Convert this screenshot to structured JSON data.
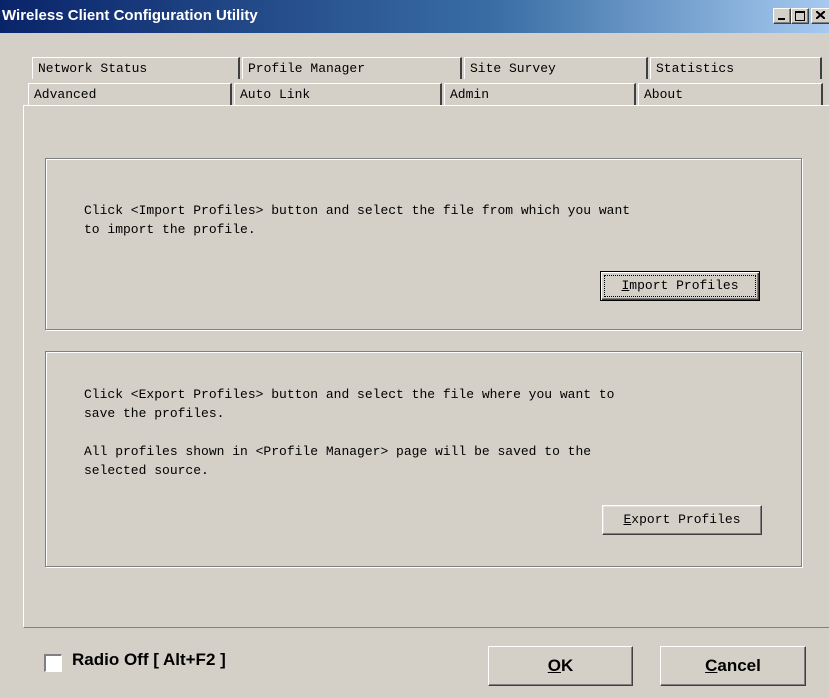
{
  "window": {
    "title": "Wireless Client Configuration Utility",
    "controls": [
      "minimize-icon",
      "maximize-icon",
      "close-icon"
    ]
  },
  "tabs": {
    "row1": [
      {
        "label": "Network Status"
      },
      {
        "label": "Profile Manager"
      },
      {
        "label": "Site Survey"
      },
      {
        "label": "Statistics"
      }
    ],
    "row2": [
      {
        "label": "Advanced"
      },
      {
        "label": "Auto Link"
      },
      {
        "label": "Admin",
        "selected": true
      },
      {
        "label": "About"
      }
    ]
  },
  "import_group": {
    "line1": "Click <Import Profiles> button and select the file from which you want",
    "line2": "to import the profile.",
    "button_label": "Import Profiles",
    "button_mnemonic": "I",
    "button_rest": "mport Profiles"
  },
  "export_group": {
    "line1": "Click <Export Profiles> button and select the file where you want to",
    "line2": "save the profiles.",
    "line3": "All profiles shown in <Profile Manager> page will be saved to the",
    "line4": "selected source.",
    "button_label": "Export Profiles",
    "button_mnemonic": "E",
    "button_rest": "xport Profiles"
  },
  "footer": {
    "radio_off_label": "Radio Off  [ Alt+F2 ]",
    "radio_off_checked": false,
    "ok_mnemonic": "O",
    "ok_rest": "K",
    "ok_label": "OK",
    "cancel_mnemonic": "C",
    "cancel_rest": "ancel",
    "cancel_label": "Cancel"
  },
  "colors": {
    "face": "#d4d0c8",
    "title_gradient_start": "#0a246a",
    "title_gradient_end": "#a6caf0"
  }
}
